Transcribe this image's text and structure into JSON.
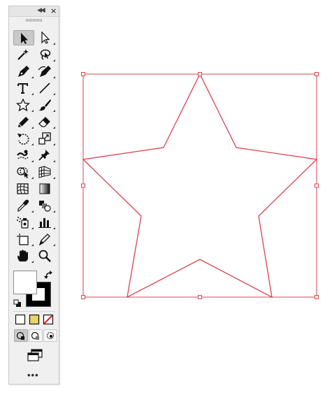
{
  "toolbar": {
    "collapse_icon": "double-chevron-left-icon",
    "close_icon": "close-icon",
    "tools": [
      [
        "selection-tool",
        "direct-selection-tool"
      ],
      [
        "magic-wand-tool",
        "lasso-tool"
      ],
      [
        "pen-tool",
        "curvature-tool"
      ],
      [
        "type-tool",
        "line-segment-tool"
      ],
      [
        "star-tool",
        "paintbrush-tool"
      ],
      [
        "pencil-tool",
        "eraser-tool"
      ],
      [
        "rotate-tool",
        "scale-tool"
      ],
      [
        "warp-tool",
        "puppet-warp-tool"
      ],
      [
        "shape-builder-tool",
        "perspective-grid-tool"
      ],
      [
        "mesh-tool",
        "gradient-tool"
      ],
      [
        "eyedropper-tool",
        "blend-tool"
      ],
      [
        "symbol-sprayer-tool",
        "column-graph-tool"
      ],
      [
        "artboard-tool",
        "slice-tool"
      ],
      [
        "hand-tool",
        "zoom-tool"
      ]
    ],
    "selected_tool": "selection-tool",
    "fill_color": "#ffffff",
    "stroke_color": "#000000",
    "more_label": "•••"
  },
  "canvas": {
    "shape": "star",
    "stroke_color": "#d9444f",
    "selection_color": "#d9444f",
    "background": "#ffffff"
  }
}
